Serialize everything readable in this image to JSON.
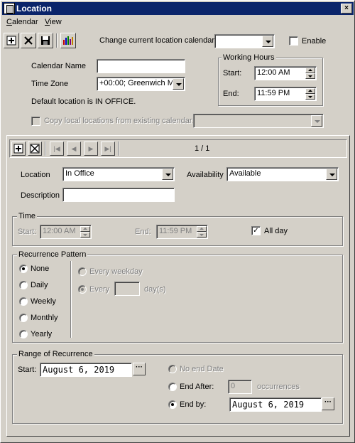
{
  "window": {
    "title": "Location",
    "close_label": "×"
  },
  "menu": [
    {
      "label": "Calendar",
      "accel": "C",
      "rest": "alendar"
    },
    {
      "label": "View",
      "accel": "V",
      "rest": "iew"
    }
  ],
  "toolbar": {
    "new_icon": "new-icon",
    "delete_icon": "delete-icon",
    "save_icon": "save-icon",
    "chart_icon": "chart-icon",
    "change_calendar_label": "Change current location calendar",
    "change_calendar_value": "",
    "enable_label": "Enable",
    "enable_checked": false
  },
  "calendar_form": {
    "name_label": "Calendar Name",
    "name_value": "",
    "timezone_label": "Time Zone",
    "timezone_value": "+00:00; Greenwich M",
    "default_location_text": "Default location is IN OFFICE.",
    "copy_label": "Copy local locations from existing calendar:",
    "copy_value": ""
  },
  "working_hours": {
    "title": "Working Hours",
    "start_label": "Start:",
    "start_value": "12:00 AM",
    "end_label": "End:",
    "end_value": "11:59 PM"
  },
  "navigator": {
    "page_text": "1 / 1"
  },
  "location": {
    "location_label": "Location",
    "location_value": "In Office",
    "availability_label": "Availability",
    "availability_value": "Available",
    "description_label": "Description",
    "description_value": ""
  },
  "time_group": {
    "title": "Time",
    "start_label": "Start:",
    "start_value": "12:00 AM",
    "end_label": "End:",
    "end_value": "11:59 PM",
    "allday_label": "All day",
    "allday_checked": true
  },
  "recurrence": {
    "title": "Recurrence Pattern",
    "options": [
      "None",
      "Daily",
      "Weekly",
      "Monthly",
      "Yearly"
    ],
    "selected": "None",
    "every_weekday_label": "Every weekday",
    "every_label": "Every",
    "every_value": "",
    "days_label": "day(s)"
  },
  "range": {
    "title": "Range of Recurrence",
    "start_label": "Start:",
    "start_value": "August 6, 2019",
    "no_end_label": "No end Date",
    "end_after_label": "End After:",
    "end_after_value": "0",
    "occurrences_label": "occurrences",
    "end_by_label": "End by:",
    "end_by_value": "August 6, 2019",
    "ellipsis_label": "···"
  }
}
